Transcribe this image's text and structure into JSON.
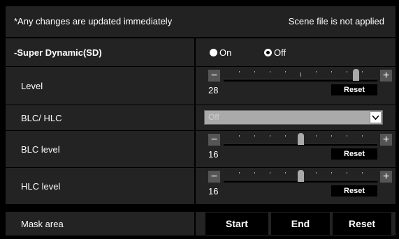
{
  "header": {
    "notice": "*Any changes are updated immediately",
    "status": "Scene file is not applied"
  },
  "super_dynamic": {
    "label": "-Super Dynamic(SD)",
    "options": [
      "On",
      "Off"
    ],
    "selected": "Off"
  },
  "level": {
    "label": "Level",
    "value": "28",
    "fraction": 0.86,
    "minus": "−",
    "plus": "+",
    "reset": "Reset"
  },
  "blc_hlc": {
    "label": "BLC/ HLC",
    "selected": "Off"
  },
  "blc_level": {
    "label": "BLC level",
    "value": "16",
    "fraction": 0.5,
    "minus": "−",
    "plus": "+",
    "reset": "Reset"
  },
  "hlc_level": {
    "label": "HLC level",
    "value": "16",
    "fraction": 0.5,
    "minus": "−",
    "plus": "+",
    "reset": "Reset"
  },
  "mask_area": {
    "label": "Mask area",
    "start": "Start",
    "end": "End",
    "reset": "Reset"
  },
  "colors": {
    "background": "#000000",
    "row": "#232323",
    "header": "#222222",
    "control": "#555555",
    "disabled": "#aaaaaa"
  },
  "icons": {
    "minus": "minus-icon",
    "plus": "plus-icon",
    "dropdown": "chevron-down-icon"
  }
}
